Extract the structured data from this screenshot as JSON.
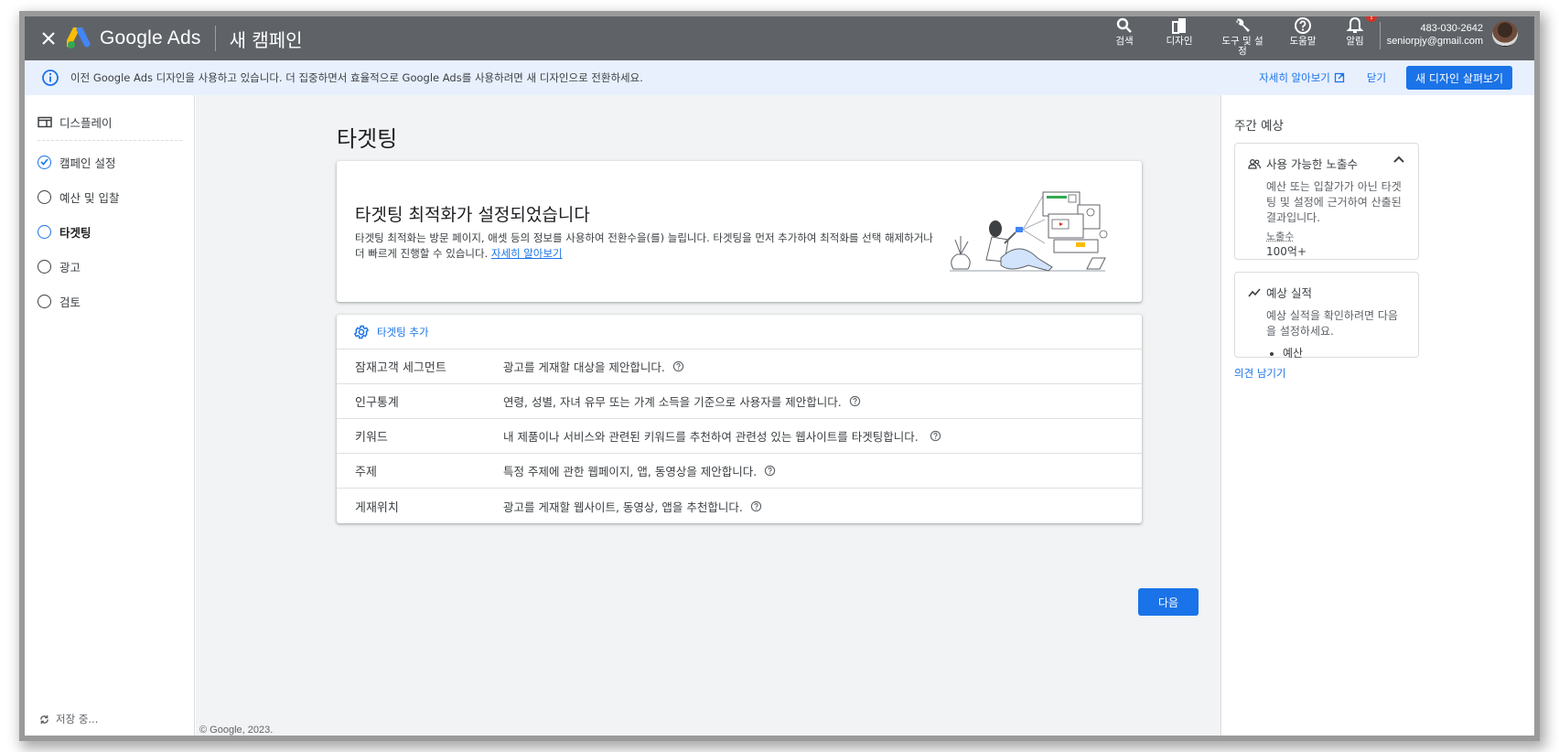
{
  "topbar": {
    "brand": "Google Ads",
    "page_name": "새 캠페인",
    "actions": [
      {
        "icon": "search-icon",
        "label": "검색"
      },
      {
        "icon": "design-icon",
        "label": "디자인"
      },
      {
        "icon": "wrench-icon",
        "label": "도구 및 설정"
      },
      {
        "icon": "help-icon",
        "label": "도움말"
      },
      {
        "icon": "bell-icon",
        "label": "알림",
        "badge": "!"
      }
    ],
    "account": {
      "customer_id": "483-030-2642",
      "email": "seniorpjy@gmail.com"
    }
  },
  "banner": {
    "message": "이전 Google Ads 디자인을 사용하고 있습니다. 더 집중하면서 효율적으로 Google Ads를 사용하려면 새 디자인으로 전환하세요.",
    "learn_more": "자세히 알아보기",
    "close": "닫기",
    "new_design_button": "새 디자인 살펴보기"
  },
  "sidebar": {
    "campaign_type": "디스플레이",
    "steps": [
      {
        "label": "캠페인 설정",
        "state": "done"
      },
      {
        "label": "예산 및 입찰",
        "state": "todo"
      },
      {
        "label": "타겟팅",
        "state": "active"
      },
      {
        "label": "광고",
        "state": "todo"
      },
      {
        "label": "검토",
        "state": "todo"
      }
    ],
    "saving_status": "저장 중..."
  },
  "main": {
    "title": "타겟팅",
    "promo": {
      "heading": "타겟팅 최적화가 설정되었습니다",
      "body": "타겟팅 최적화는 방문 페이지, 애셋 등의 정보를 사용하여 전환수을(를) 늘립니다. 타겟팅을 먼저 추가하여 최적화를 선택 해제하거나 더 빠르게 진행할 수 있습니다.",
      "link": "자세히 알아보기"
    },
    "add_targeting": "타겟팅 추가",
    "targeting_rows": [
      {
        "name": "잠재고객 세그먼트",
        "description": "광고를 게재할 대상을 제안합니다."
      },
      {
        "name": "인구통계",
        "description": "연령, 성별, 자녀 유무 또는 가계 소득을 기준으로 사용자를 제안합니다."
      },
      {
        "name": "키워드",
        "description": "내 제품이나 서비스와 관련된 키워드를 추천하여 관련성 있는 웹사이트를 타겟팅합니다."
      },
      {
        "name": "주제",
        "description": "특정 주제에 관한 웹페이지, 앱, 동영상을 제안합니다."
      },
      {
        "name": "게재위치",
        "description": "광고를 게재할 웹사이트, 동영상, 앱을 추천합니다."
      }
    ],
    "next_button": "다음",
    "copyright": "© Google, 2023."
  },
  "right_panel": {
    "title": "주간 예상",
    "reach_card": {
      "title": "사용 가능한 노출수",
      "body": "예산 또는 입찰가가 아닌 타겟팅 및 설정에 근거하여 산출된 결과입니다.",
      "metric_label": "노출수",
      "metric_value": "100억+"
    },
    "performance_card": {
      "title": "예상 실적",
      "body": "예상 실적을 확인하려면 다음을 설정하세요.",
      "items": [
        "예산"
      ]
    },
    "feedback_link": "의견 남기기"
  },
  "colors": {
    "topbar": "#5f6368",
    "accent": "#1a73e8",
    "banner_bg": "#e8f0fe",
    "main_bg": "#f1f3f4",
    "alert": "#d93025"
  }
}
